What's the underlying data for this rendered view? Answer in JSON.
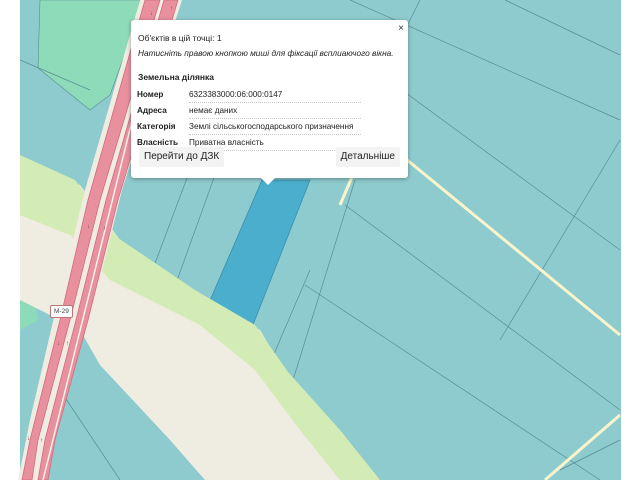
{
  "map": {
    "road_label": "М-29",
    "colors": {
      "parcel_fill": "#8ecbce",
      "parcel_border": "#5a8c92",
      "selected_parcel": "#4aaecc",
      "road_main": "#e8909e",
      "road_casing": "#d46a7c",
      "road_side": "#efece2",
      "green_strip": "#d3ebb4",
      "meadow": "#8edbb9",
      "field_road": "#fbf4cb"
    }
  },
  "popup": {
    "close_icon": "×",
    "objects_count": "Об'єктів в цій точці: 1",
    "hint": "Натисніть правою кнопкою миші для фіксації всплиаючого вікна.",
    "section_title": "Земельна ділянка",
    "attributes": [
      {
        "key": "Номер",
        "value": "6323383000:06:000:0147"
      },
      {
        "key": "Адреса",
        "value": "немає даних"
      },
      {
        "key": "Категорія",
        "value": "Землі сільськогосподарського призначення"
      },
      {
        "key": "Власність",
        "value": "Приватна власність"
      }
    ],
    "buttons": {
      "dzk": "Перейти до ДЗК",
      "more": "Детальніше"
    }
  }
}
